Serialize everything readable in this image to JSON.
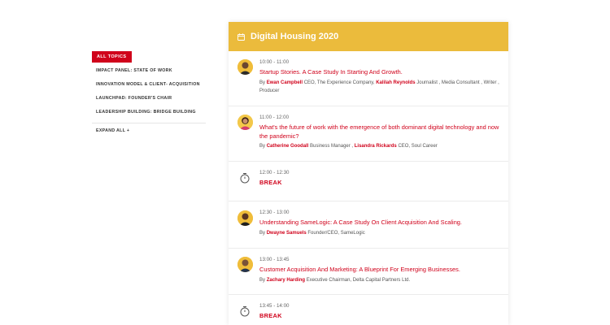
{
  "sidebar": {
    "active_topic": "ALL TOPICS",
    "topics": [
      "IMPACT PANEL: STATE OF WORK",
      "INNOVATION MODEL & CLIENT- ACQUISITION",
      "LAUNCHPAD: FOUNDER'S CHAIR",
      "LEADERSHIP BUILDING: BRIDGE BUILDING"
    ],
    "expand_all": "EXPAND ALL +"
  },
  "panel": {
    "title": "Digital Housing 2020",
    "header_color": "#ebbb3c",
    "accent": "#d0021b",
    "sessions": [
      {
        "time": "10:00 - 11:00",
        "title": "Startup Stories. A Case Study In Starting And Growth.",
        "by": "By",
        "s1_name": "Ewan Campbell",
        "s1_role": "CEO, The Experience Company,",
        "s2_name": "Kalilah Reynolds",
        "s2_role": "Journalist , Media Consultant , Writer , Producer"
      },
      {
        "time": "11:00 - 12:00",
        "title": "What's the future of work with the emergence of both dominant digital technology and now the pandemic?",
        "by": "By",
        "s1_name": "Catherine Goodall",
        "s1_role": "Business Manager ,",
        "s2_name": "Lisandra Rickards",
        "s2_role": "CEO, Soul Career"
      },
      {
        "time": "12:00 - 12:30",
        "title": "BREAK"
      },
      {
        "time": "12:30 - 13:00",
        "title": "Understanding SameLogic: A Case Study On Client Acquisition And Scaling.",
        "by": "By",
        "s1_name": "Dwayne Samuels",
        "s1_role": "Founder/CEO, SameLogic"
      },
      {
        "time": "13:00 - 13:45",
        "title": "Customer Acquisition And Marketing: A Blueprint For Emerging Businesses.",
        "by": "By",
        "s1_name": "Zachary Harding",
        "s1_role": "Executive Chairman, Delta Capital Partners Ltd."
      },
      {
        "time": "13:45 - 14:00",
        "title": "BREAK"
      }
    ]
  }
}
